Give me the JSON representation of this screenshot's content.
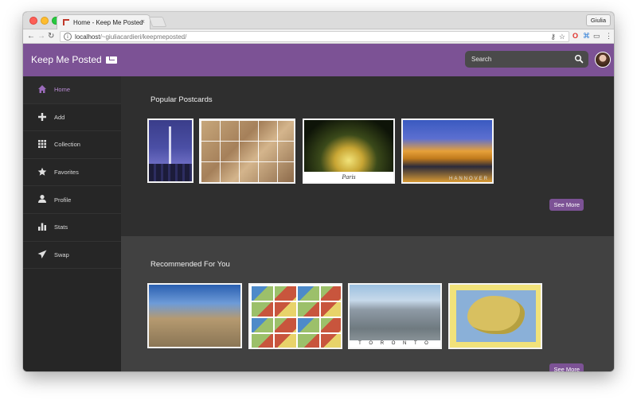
{
  "browser": {
    "tab_title": "Home - Keep Me Posted",
    "tab_close": "×",
    "profile_name": "Giulia",
    "url_host": "localhost",
    "url_path": "/~giuliacardieri/keepmeposted/"
  },
  "app": {
    "brand": "Keep Me Posted",
    "accent_color": "#7c5295",
    "search": {
      "placeholder": "Search"
    }
  },
  "sidebar": {
    "items": [
      {
        "label": "Home",
        "icon": "home-icon",
        "active": true
      },
      {
        "label": "Add",
        "icon": "plus-icon",
        "active": false
      },
      {
        "label": "Collection",
        "icon": "grid-icon",
        "active": false
      },
      {
        "label": "Favorites",
        "icon": "star-icon",
        "active": false
      },
      {
        "label": "Profile",
        "icon": "user-icon",
        "active": false
      },
      {
        "label": "Stats",
        "icon": "bar-chart-icon",
        "active": false
      },
      {
        "label": "Swap",
        "icon": "paper-plane-icon",
        "active": false
      }
    ]
  },
  "popular": {
    "title": "Popular Postcards",
    "see_more": "See More",
    "postcards": [
      {
        "caption": ""
      },
      {
        "caption": ""
      },
      {
        "caption": "Paris"
      },
      {
        "caption": "HANNOVER"
      }
    ]
  },
  "recommended": {
    "title": "Recommended For You",
    "see_more": "See More",
    "postcards": [
      {
        "caption": ""
      },
      {
        "caption": ""
      },
      {
        "caption": "T O R O N T O"
      },
      {
        "caption": ""
      }
    ]
  }
}
